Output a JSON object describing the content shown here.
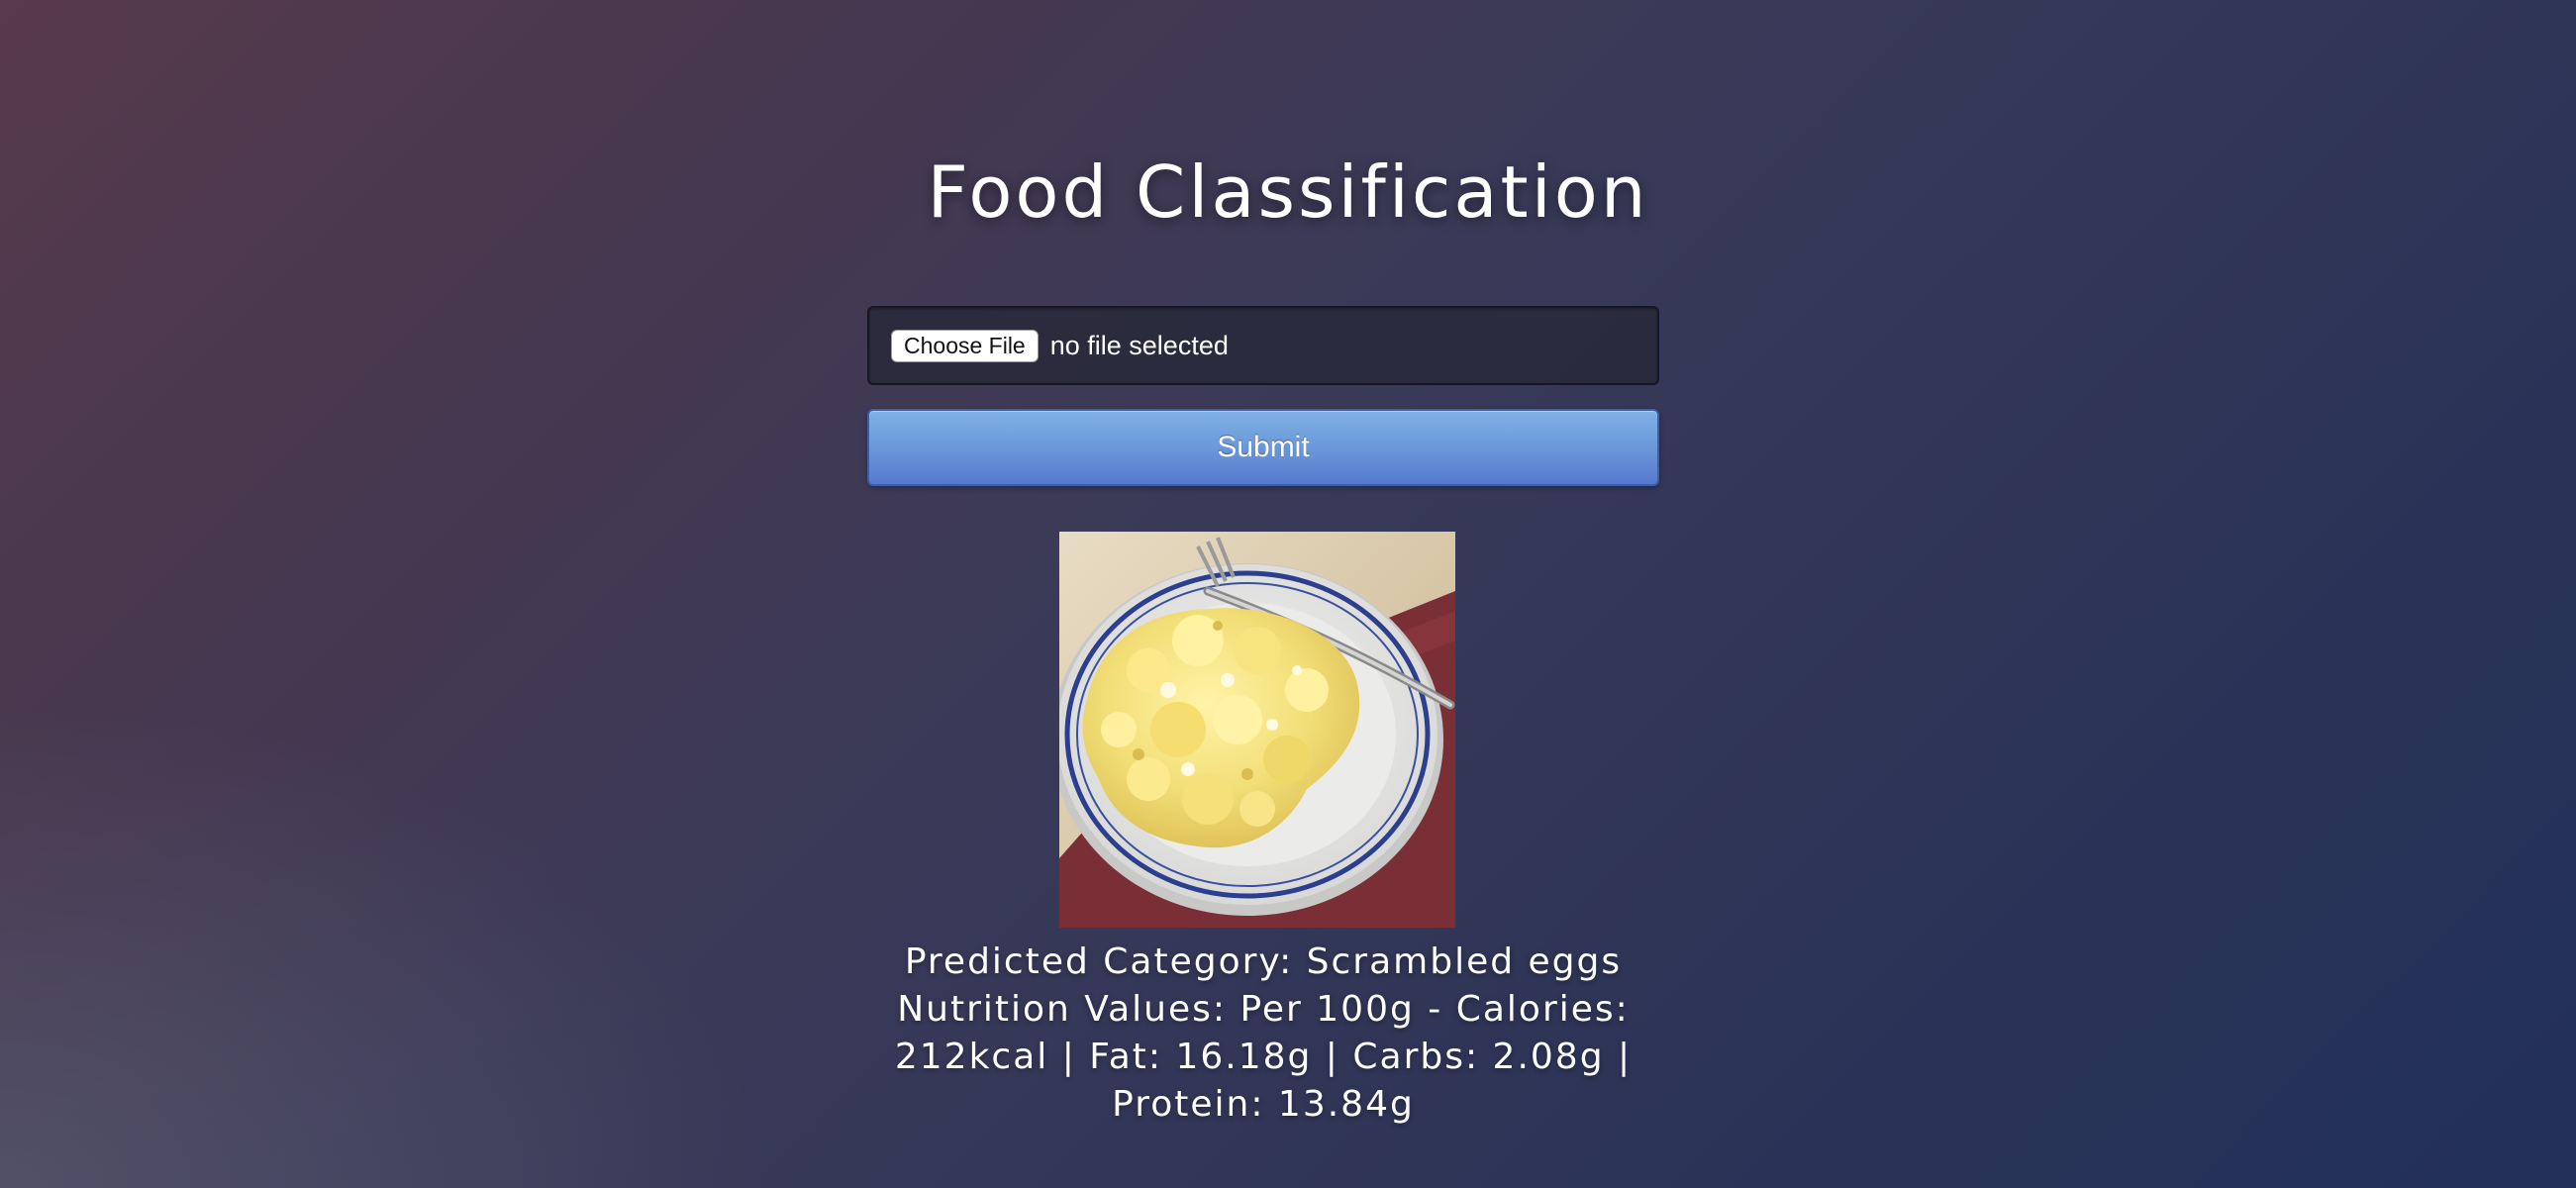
{
  "page": {
    "title": "Food Classification"
  },
  "upload": {
    "choose_file_label": "Choose File",
    "file_status": "no file selected"
  },
  "submit": {
    "label": "Submit"
  },
  "result": {
    "predicted_category": "Predicted Category: Scrambled eggs",
    "nutrition_values": "Nutrition Values: Per 100g - Calories: 212kcal | Fat: 16.18g | Carbs: 2.08g | Protein: 13.84g"
  },
  "colors": {
    "submit_top": "#7fb2e6",
    "submit_bottom": "#5679cf",
    "background_start": "#573a4c",
    "background_end": "#22305a"
  }
}
